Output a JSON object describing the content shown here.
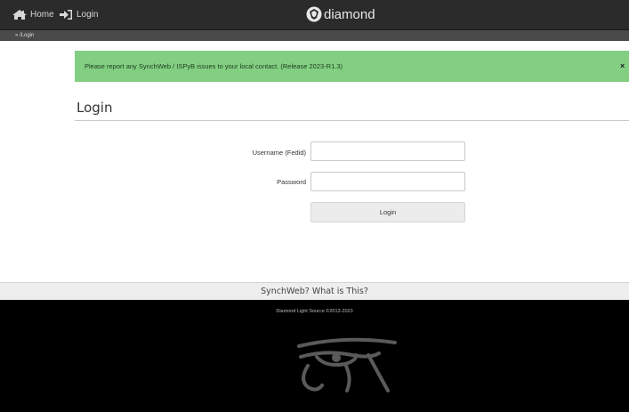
{
  "nav": {
    "home_label": "Home",
    "login_label": "Login",
    "brand_label": "diamond"
  },
  "breadcrumb": {
    "text": "» /Login"
  },
  "alert": {
    "message": "Please report any SynchWeb / ISPyB issues to your local contact. (Release 2023-R1.3)",
    "close": "×"
  },
  "login": {
    "title": "Login",
    "username_label": "Username (Fedid)",
    "username_value": "",
    "password_label": "Password",
    "password_value": "",
    "submit_label": "Login"
  },
  "info_bar": {
    "text": "SynchWeb? What is This?"
  },
  "footer": {
    "copyright": "Diamond Light Source ©2013-2023"
  },
  "colors": {
    "topbar": "#2b2b2b",
    "alert_bg": "#82cf82",
    "footer_bg": "#000000"
  },
  "icons": {
    "home": "home-icon",
    "login": "sign-in-icon",
    "brand": "diamond-logo-icon",
    "footer_logo": "eye-of-horus-icon"
  }
}
